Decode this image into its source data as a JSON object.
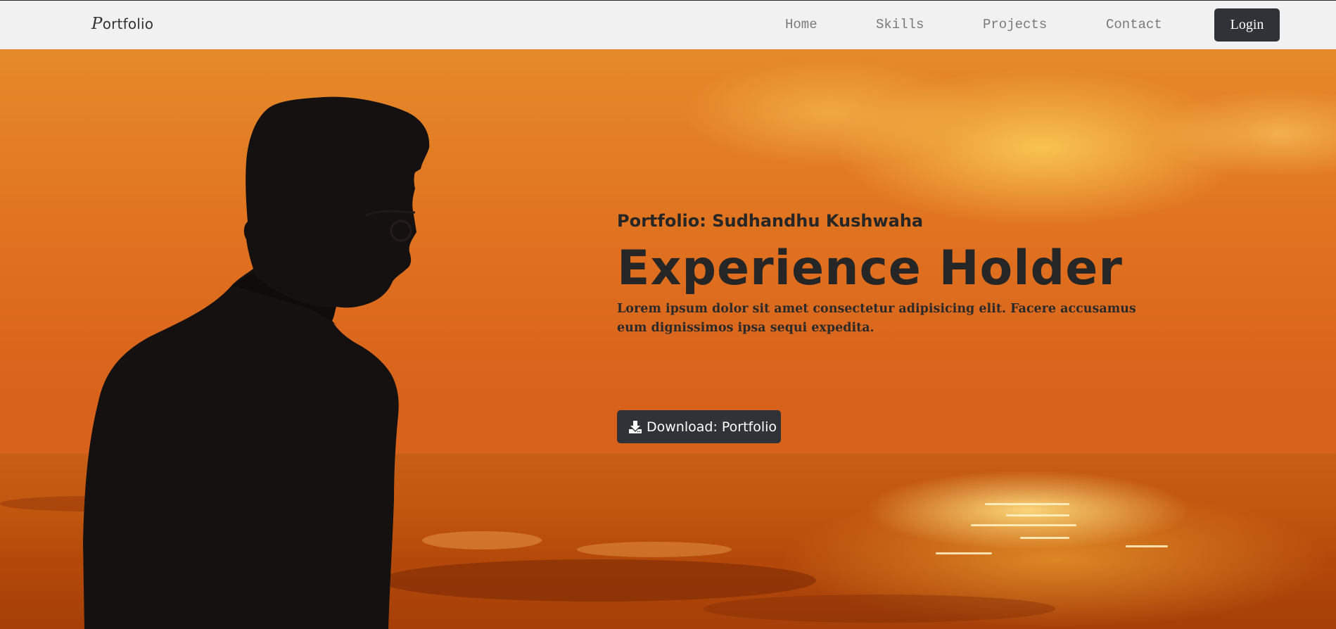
{
  "navbar": {
    "brand": "Portfolio",
    "links": [
      "Home",
      "Skills",
      "Projects",
      "Contact"
    ],
    "login_label": "Login"
  },
  "hero": {
    "subtitle": "Portfolio: Sudhandhu Kushwaha",
    "headline": "Experience Holder",
    "description": "Lorem ipsum dolor sit amet consectetur adipisicing elit. Facere accusamus eum dignissimos ipsa sequi expedita.",
    "download_label": "Download: Portfolio",
    "download_icon": "download-icon",
    "background_image": "sunset-sea-with-man-silhouette"
  },
  "colors": {
    "navbar_bg": "#f1f1f1",
    "button_bg": "#2f3237",
    "nav_link": "#7a7a7a",
    "hero_orange": "#e0701f",
    "text_dark": "#262626"
  }
}
